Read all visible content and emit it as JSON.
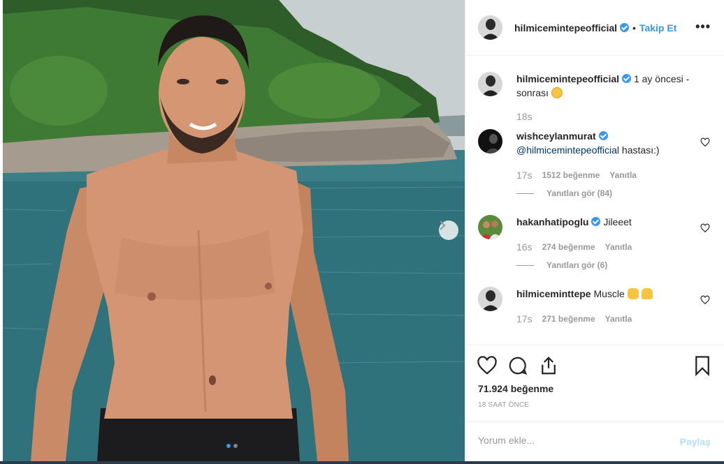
{
  "header": {
    "username": "hilmicemintepeofficial",
    "separator": "•",
    "follow_label": "Takip Et",
    "more_label": "•••"
  },
  "caption": {
    "username": "hilmicemintepeofficial",
    "text": "1 ay öncesi - sonrası",
    "time": "18s"
  },
  "comments": [
    {
      "username": "wishceylanmurat",
      "mention": "@hilmicemintepeofficial",
      "text": " hastası:)",
      "time": "17s",
      "likes": "1512 beğenme",
      "reply": "Yanıtla",
      "view_replies": "Yanıtları gör (84)"
    },
    {
      "username": "hakanhatipoglu",
      "text": "Jileeet",
      "time": "16s",
      "likes": "274 beğenme",
      "reply": "Yanıtla",
      "view_replies": "Yanıtları gör (6)"
    },
    {
      "username": "hilmiceminttepe",
      "text": "Muscle",
      "time": "17s",
      "likes": "271 beğenme",
      "reply": "Yanıtla"
    }
  ],
  "actions": {
    "like_count": "71.924 beğenme",
    "posted_ago": "18 SAAT ÖNCE"
  },
  "add_comment": {
    "placeholder": "Yorum ekle...",
    "post_label": "Paylaş"
  },
  "carousel": {
    "slides": 2,
    "active_slide": 1
  },
  "colors": {
    "accent": "#3897f0",
    "muted": "#999999",
    "post_disabled": "#b2dffc"
  }
}
